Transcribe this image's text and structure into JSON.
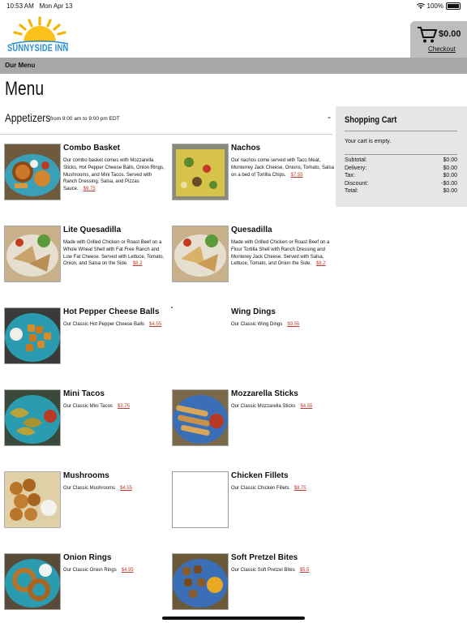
{
  "status": {
    "time": "10:53 AM",
    "date": "Mon Apr 13",
    "battery": "100%"
  },
  "brand": {
    "name": "SUNNYSIDE INN"
  },
  "cart": {
    "total": "$0.00",
    "checkout_label": "Checkout"
  },
  "nav": {
    "current": "Our Menu"
  },
  "page": {
    "title": "Menu"
  },
  "section": {
    "name": "Appetizers",
    "hours": "from 9:00 am to 9:00 pm EDT",
    "toggle": "-"
  },
  "items": [
    {
      "name": "Combo Basket",
      "desc": "Our combo basket comes with Mozzarella Sticks, Hot Pepper Cheese Balls, Onion Rings, Mushrooms, and Mini Tacos. Served with Ranch Dressing, Salsa, and Pizzas Sauce.",
      "price": "$9.75",
      "image": "combo-basket"
    },
    {
      "name": "Nachos",
      "desc": "Our nachos come served with Taco Meat, Monterrey Jack Cheese, Onions, Tomato, Salsa on a bed of Tortilla Chips.",
      "price": "$7.55",
      "image": "nachos"
    },
    {
      "name": "Lite Quesadilla",
      "desc": "Made with Grilled Chicken or Roast Beef on a Whole Wheat Shell with Fat Free Ranch and Low Fat Cheese. Served with Lettuce, Tomato, Onion, and Salsa on the Side.",
      "price": "$8.2",
      "image": "quesadilla"
    },
    {
      "name": "Quesadilla",
      "desc": "Made with Grilled Chicken or Roast Beef on a Flour Tortilla Shell with Ranch Dressing and Monterey Jack Cheese. Served with Salsa, Lettuce, Tomato, and Onion the Side.",
      "price": "$8.2",
      "image": "quesadilla"
    },
    {
      "name": "Hot Pepper Cheese Balls",
      "desc": "Our Classic Hot Pepper Cheese Balls",
      "price": "$4.55",
      "image": "cheese-balls"
    },
    {
      "name": "Wing Dings",
      "desc": "Our Classic Wing Dings",
      "price": "$9.55",
      "image": "none"
    },
    {
      "name": "Mini Tacos",
      "desc": "Our Classic Mini Tacos",
      "price": "$3.75",
      "image": "mini-tacos"
    },
    {
      "name": "Mozzarella Sticks",
      "desc": "Our Classic Mozzarella Sticks",
      "price": "$4.55",
      "image": "mozzarella"
    },
    {
      "name": "Mushrooms",
      "desc": "Our Classic Mushrooms",
      "price": "$4.55",
      "image": "mushrooms"
    },
    {
      "name": "Chicken Fillets",
      "desc": "Our Classic Chicken Fillets",
      "price": "$8.75",
      "image": "blank"
    },
    {
      "name": "Onion Rings",
      "desc": "Our Classic Onion Rings",
      "price": "$4.95",
      "image": "onion-rings"
    },
    {
      "name": "Soft Pretzel Bites",
      "desc": "Our Classic Soft Pretzel Bites",
      "price": "$5.5",
      "image": "pretzel"
    }
  ],
  "cart_panel": {
    "title": "Shopping Cart",
    "empty_text": "Your cart is empty.",
    "rows": [
      {
        "label": "Subtotal:",
        "value": "$0.00"
      },
      {
        "label": "Delivery:",
        "value": "$0.00"
      },
      {
        "label": "Tax:",
        "value": "$0.00"
      },
      {
        "label": "Discount:",
        "value": "-$0.00"
      },
      {
        "label": "Total:",
        "value": "$0.00"
      }
    ]
  }
}
